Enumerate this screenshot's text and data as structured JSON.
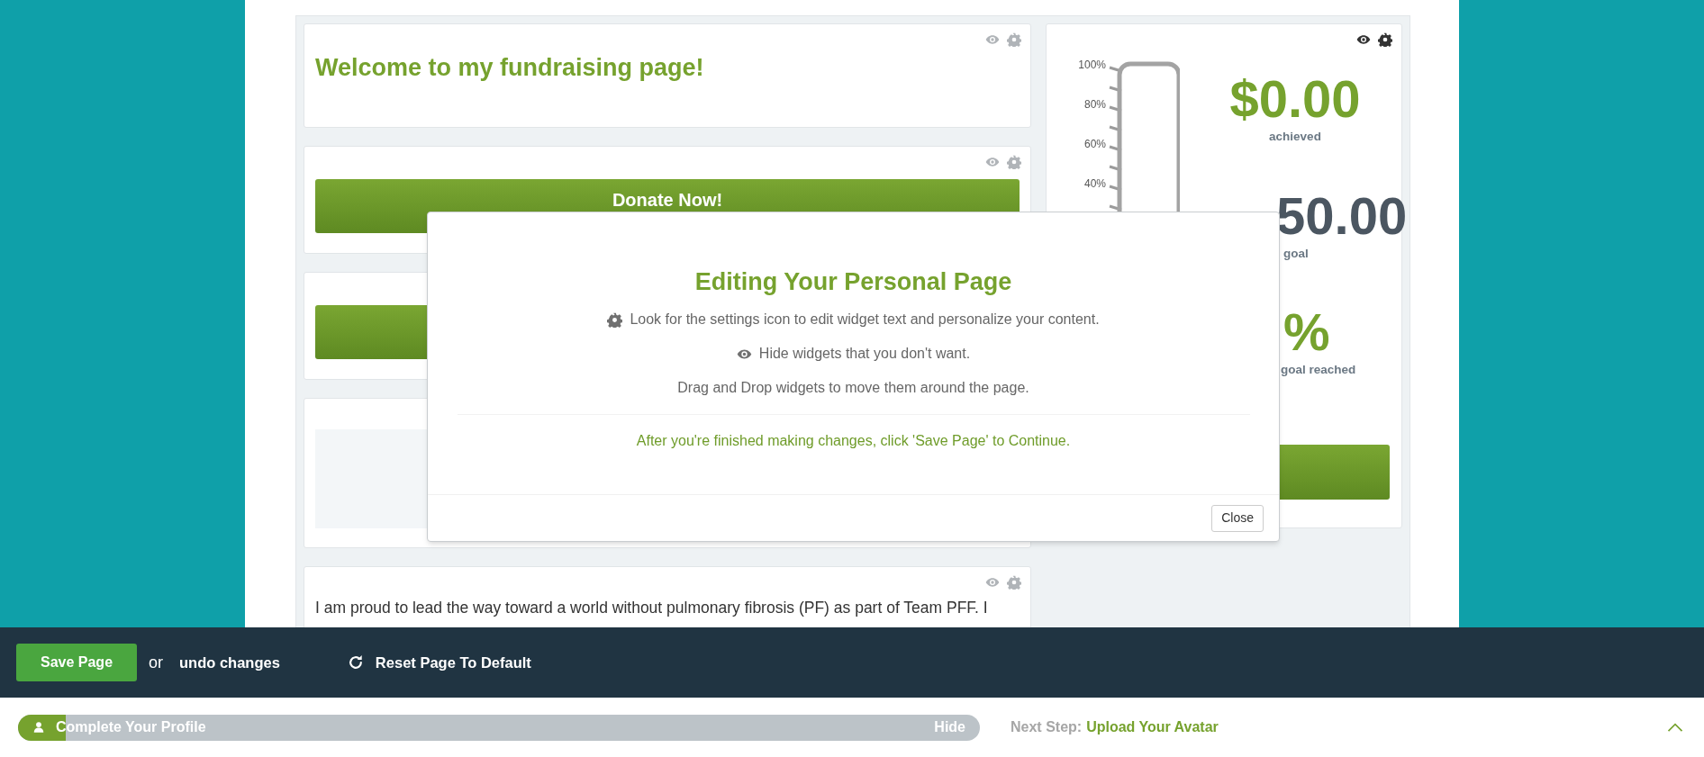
{
  "widgets": [
    {
      "kind": "heading",
      "text": "Welcome to my fundraising page!"
    },
    {
      "kind": "button",
      "label": "Donate Now!"
    },
    {
      "kind": "button"
    },
    {
      "kind": "placeholder"
    },
    {
      "kind": "text",
      "paragraphs": [
        "I am proud to lead the way toward a world without pulmonary fibrosis (PF) as part of Team PFF. I"
      ]
    }
  ],
  "thermometer": {
    "ticks": [
      "100%",
      "80%",
      "60%",
      "40%"
    ],
    "stats": [
      {
        "kind": "achieved",
        "value": "$0.00",
        "label": "achieved"
      },
      {
        "kind": "goal",
        "value": "50.00",
        "label": "goal"
      },
      {
        "kind": "percent",
        "value": "%",
        "label": "goal reached"
      }
    ]
  },
  "modal": {
    "title": "Editing Your Personal Page",
    "lines": [
      {
        "kind": "settings",
        "text": "Look for the settings icon to edit widget text and personalize your content."
      },
      {
        "kind": "hide",
        "text": "Hide widgets that you don't want."
      },
      {
        "kind": "plain",
        "text": "Drag and Drop widgets to move them around the page."
      }
    ],
    "note": "After you're finished making changes, click 'Save Page' to Continue.",
    "close": "Close"
  },
  "edit_bar": {
    "save": "Save Page",
    "or": "or",
    "undo": "undo changes",
    "reset": "Reset Page To Default"
  },
  "profile_bar": {
    "label": "Complete Your Profile",
    "level": 0.05,
    "hide": "Hide",
    "next_label": "Next Step:",
    "next_link": "Upload Your Avatar"
  }
}
